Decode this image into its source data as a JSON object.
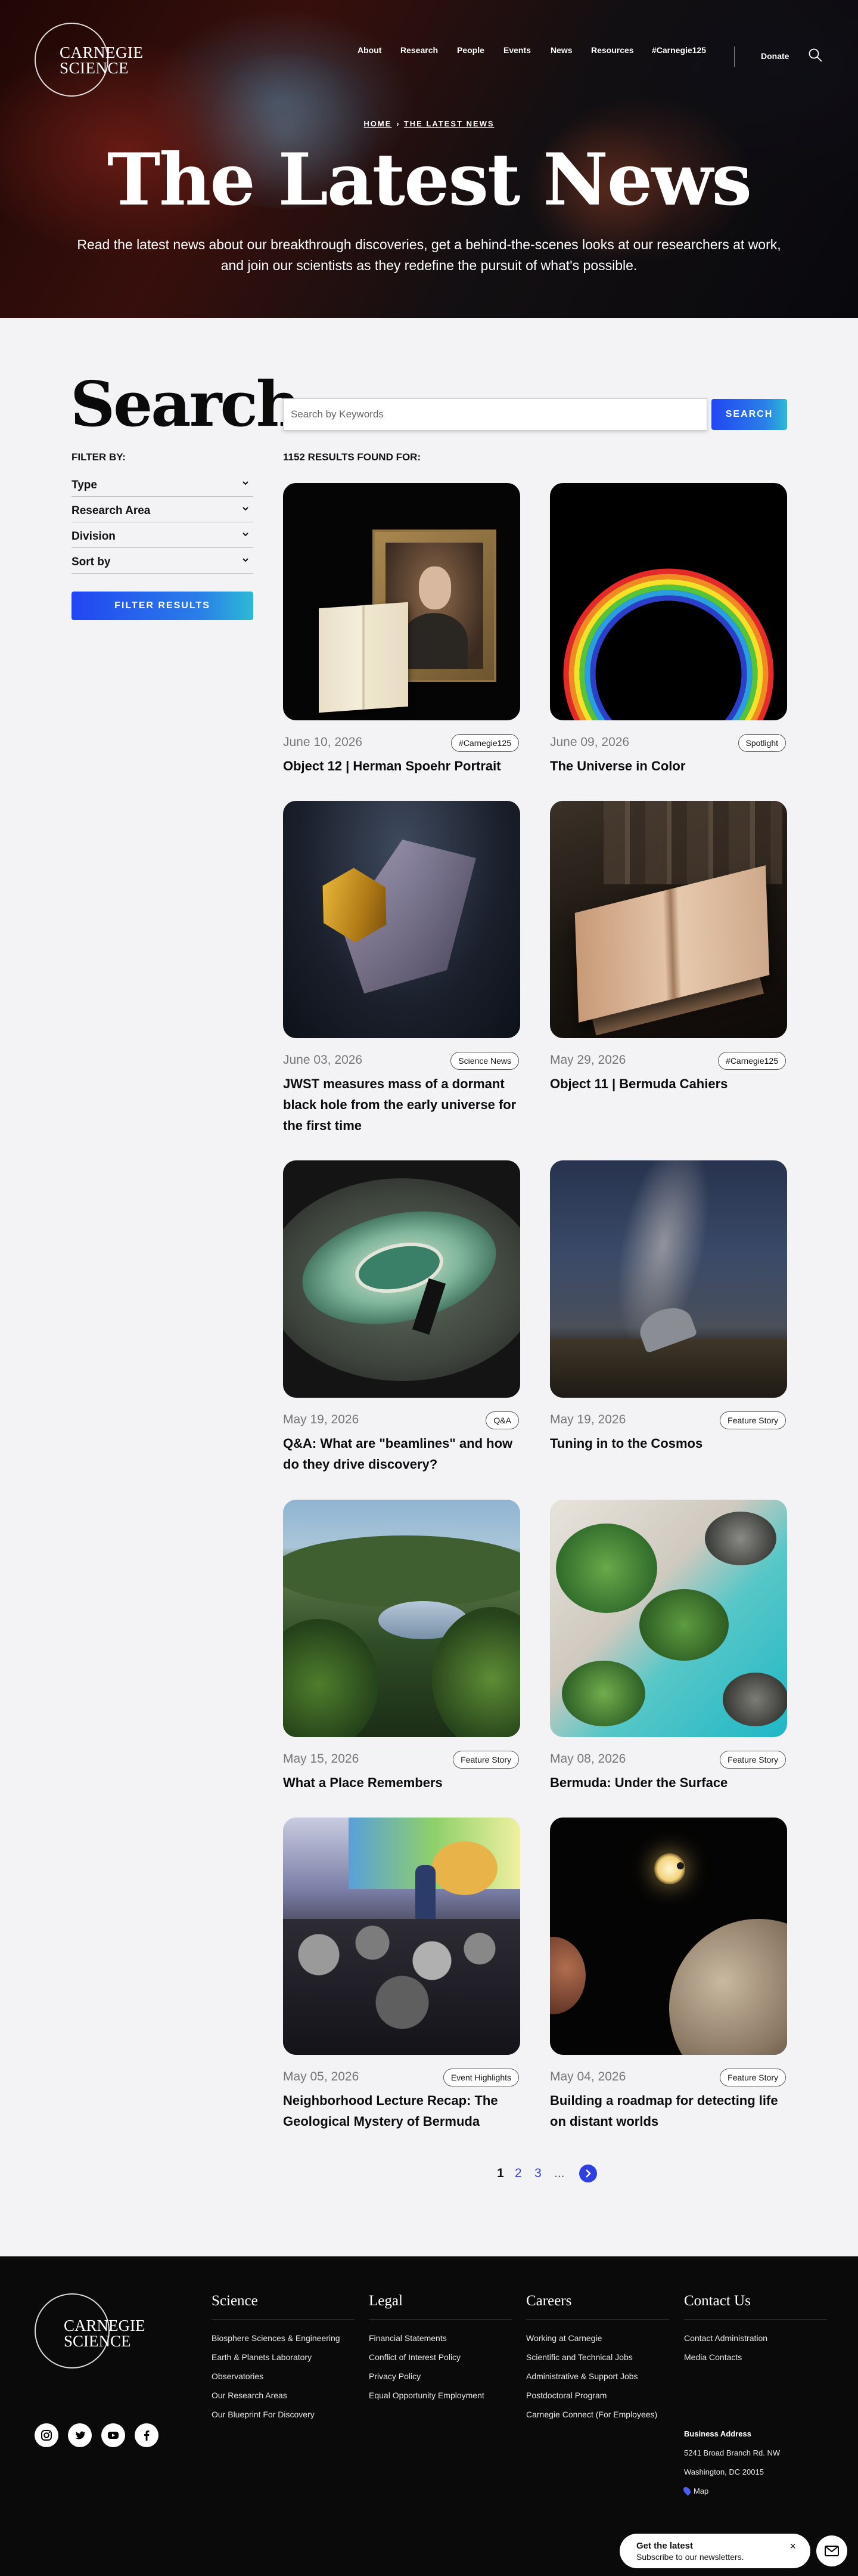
{
  "header": {
    "logo_line1": "CARNEGIE",
    "logo_line2": "SCIENCE",
    "nav": [
      "About",
      "Research",
      "People",
      "Events",
      "News",
      "Resources",
      "#Carnegie125"
    ],
    "donate": "Donate"
  },
  "hero": {
    "breadcrumb_home": "HOME",
    "breadcrumb_current": "THE LATEST NEWS",
    "title": "The Latest News",
    "subtitle_line1": "Read the latest news about our breakthrough discoveries, get a behind-the-scenes looks at our researchers at work,",
    "subtitle_line2": "and join our scientists as they redefine the pursuit of what's possible."
  },
  "search": {
    "title": "Search",
    "placeholder": "Search by Keywords",
    "button": "SEARCH",
    "filter_by": "FILTER BY:",
    "filters": [
      "Type",
      "Research Area",
      "Division",
      "Sort by"
    ],
    "filter_button": "FILTER RESULTS",
    "results": "1152 RESULTS FOUND FOR:"
  },
  "cards": [
    {
      "date": "June 10, 2026",
      "tag": "#Carnegie125",
      "title": "Object 12 | Herman Spoehr Portrait"
    },
    {
      "date": "June 09, 2026",
      "tag": "Spotlight",
      "title": "The Universe in Color"
    },
    {
      "date": "June 03, 2026",
      "tag": "Science News",
      "title": "JWST measures mass of a dormant black hole from the early universe for the first time"
    },
    {
      "date": "May 29, 2026",
      "tag": "#Carnegie125",
      "title": "Object 11 | Bermuda Cahiers"
    },
    {
      "date": "May 19, 2026",
      "tag": "Q&A",
      "title": "Q&A: What are \"beamlines\" and how do they drive discovery?"
    },
    {
      "date": "May 19, 2026",
      "tag": "Feature Story",
      "title": "Tuning in to the Cosmos"
    },
    {
      "date": "May 15, 2026",
      "tag": "Feature Story",
      "title": "What a Place Remembers"
    },
    {
      "date": "May 08, 2026",
      "tag": "Feature Story",
      "title": "Bermuda: Under the Surface"
    },
    {
      "date": "May 05, 2026",
      "tag": "Event Highlights",
      "title": "Neighborhood Lecture Recap: The Geological Mystery of Bermuda"
    },
    {
      "date": "May 04, 2026",
      "tag": "Feature Story",
      "title": "Building a roadmap for detecting life on distant worlds"
    }
  ],
  "pagination": {
    "pages": [
      "1",
      "2",
      "3"
    ],
    "ellipsis": "...",
    "current": "1"
  },
  "footer": {
    "logo_line1": "CARNEGIE",
    "logo_line2": "SCIENCE",
    "columns": [
      {
        "heading": "Science",
        "links": [
          "Biosphere Sciences & Engineering",
          "Earth & Planets Laboratory",
          "Observatories",
          "Our Research Areas",
          "Our Blueprint For Discovery"
        ]
      },
      {
        "heading": "Legal",
        "links": [
          "Financial Statements",
          "Conflict of Interest Policy",
          "Privacy Policy",
          "Equal Opportunity Employment"
        ]
      },
      {
        "heading": "Careers",
        "links": [
          "Working at Carnegie",
          "Scientific and Technical Jobs",
          "Administrative & Support Jobs",
          "Postdoctoral Program",
          "Carnegie Connect (For Employees)"
        ]
      },
      {
        "heading": "Contact Us",
        "links": [
          "Contact Administration",
          "Media Contacts"
        ]
      }
    ],
    "address_label": "Business Address",
    "address_line1": "5241 Broad Branch Rd. NW",
    "address_line2": "Washington, DC 20015",
    "map": "Map",
    "social": [
      "instagram-icon",
      "twitter-icon",
      "youtube-icon",
      "facebook-icon"
    ]
  },
  "newsletter": {
    "line1": "Get the latest",
    "line2": "Subscribe to our newsletters.",
    "close": "×"
  },
  "colors": {
    "accent": "#2246f2",
    "accent_end": "#2db9d6",
    "footer_bg": "#0a0a0a",
    "page_bg": "#f3f3f5"
  }
}
